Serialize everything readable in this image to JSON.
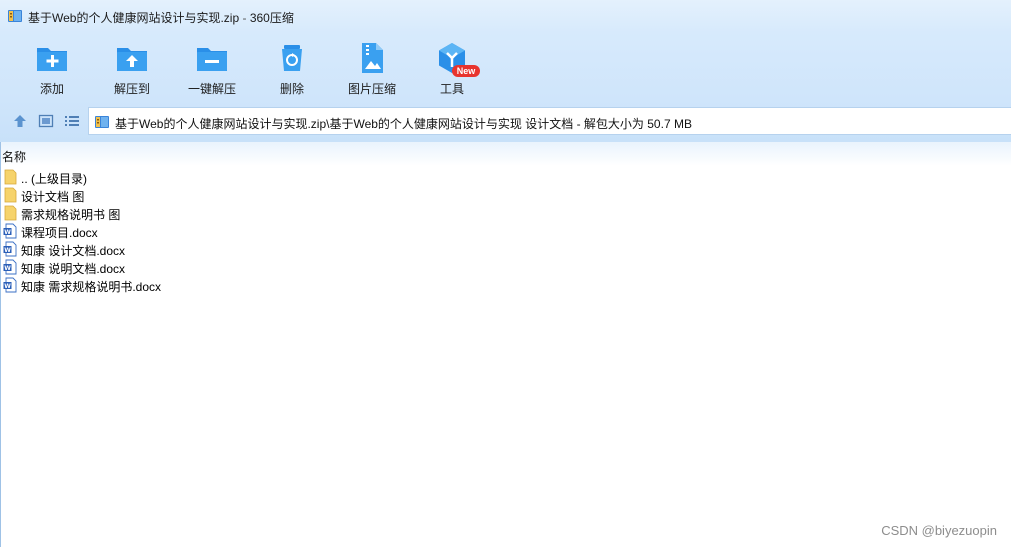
{
  "window": {
    "title_file": "基于Web的个人健康网站设计与实现.zip",
    "title_sep": " - ",
    "app_name": "360压缩"
  },
  "toolbar": {
    "buttons": [
      {
        "label": "添加",
        "icon": "folder-plus-icon"
      },
      {
        "label": "解压到",
        "icon": "folder-extract-icon"
      },
      {
        "label": "一键解压",
        "icon": "folder-minus-icon"
      },
      {
        "label": "删除",
        "icon": "recycle-bin-icon"
      },
      {
        "label": "图片压缩",
        "icon": "image-zip-icon"
      },
      {
        "label": "工具",
        "icon": "tools-cube-icon"
      }
    ],
    "new_badge": "New"
  },
  "address": {
    "path": "基于Web的个人健康网站设计与实现.zip\\基于Web的个人健康网站设计与实现 设计文档 - 解包大小为 50.7 MB"
  },
  "list": {
    "column_name": "名称",
    "items": [
      {
        "name": ".. (上级目录)",
        "type": "folder-up"
      },
      {
        "name": "设计文档 图",
        "type": "folder"
      },
      {
        "name": "需求规格说明书 图",
        "type": "folder"
      },
      {
        "name": "课程项目.docx",
        "type": "docx"
      },
      {
        "name": "知康 设计文档.docx",
        "type": "docx"
      },
      {
        "name": "知康 说明文档.docx",
        "type": "docx"
      },
      {
        "name": "知康 需求规格说明书.docx",
        "type": "docx"
      }
    ]
  },
  "watermark": "CSDN @biyezuopin",
  "colors": {
    "accent_blue": "#2a8fe8",
    "badge_red": "#e8342e",
    "folder_yellow": "#f6d36b"
  }
}
